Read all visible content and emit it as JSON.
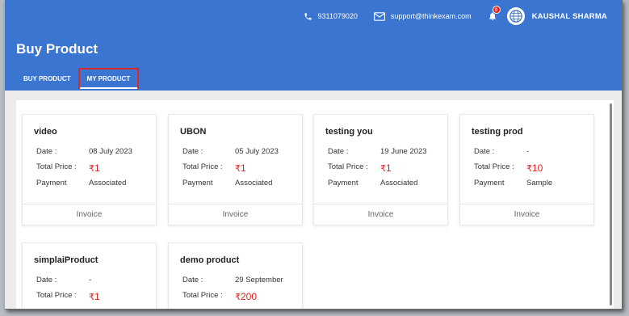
{
  "header": {
    "phone": "9311079020",
    "email": "support@thinkexam.com",
    "notification_count": "0",
    "user_name": "KAUSHAL SHARMA",
    "page_title": "Buy Product"
  },
  "tabs": [
    {
      "label": "BUY PRODUCT"
    },
    {
      "label": "MY PRODUCT"
    }
  ],
  "labels": {
    "date": "Date :",
    "total_price": "Total Price :",
    "payment": "Payment",
    "invoice": "Invoice",
    "rupee": "₹"
  },
  "products": [
    {
      "name": "video",
      "date": "08 July 2023",
      "price": "1",
      "payment": "Associated"
    },
    {
      "name": "UBON",
      "date": "05 July 2023",
      "price": "1",
      "payment": "Associated"
    },
    {
      "name": "testing you",
      "date": "19 June 2023",
      "price": "1",
      "payment": "Associated"
    },
    {
      "name": "testing prod",
      "date": "-",
      "price": "10",
      "payment": "Sample"
    },
    {
      "name": "simplaiProduct",
      "date": "-",
      "price": "1"
    },
    {
      "name": "demo product",
      "date": "29 September",
      "price": "200"
    }
  ],
  "colors": {
    "primary": "#3a75d1",
    "price": "#e0201f",
    "active_tab_border": "#d92a2a"
  }
}
